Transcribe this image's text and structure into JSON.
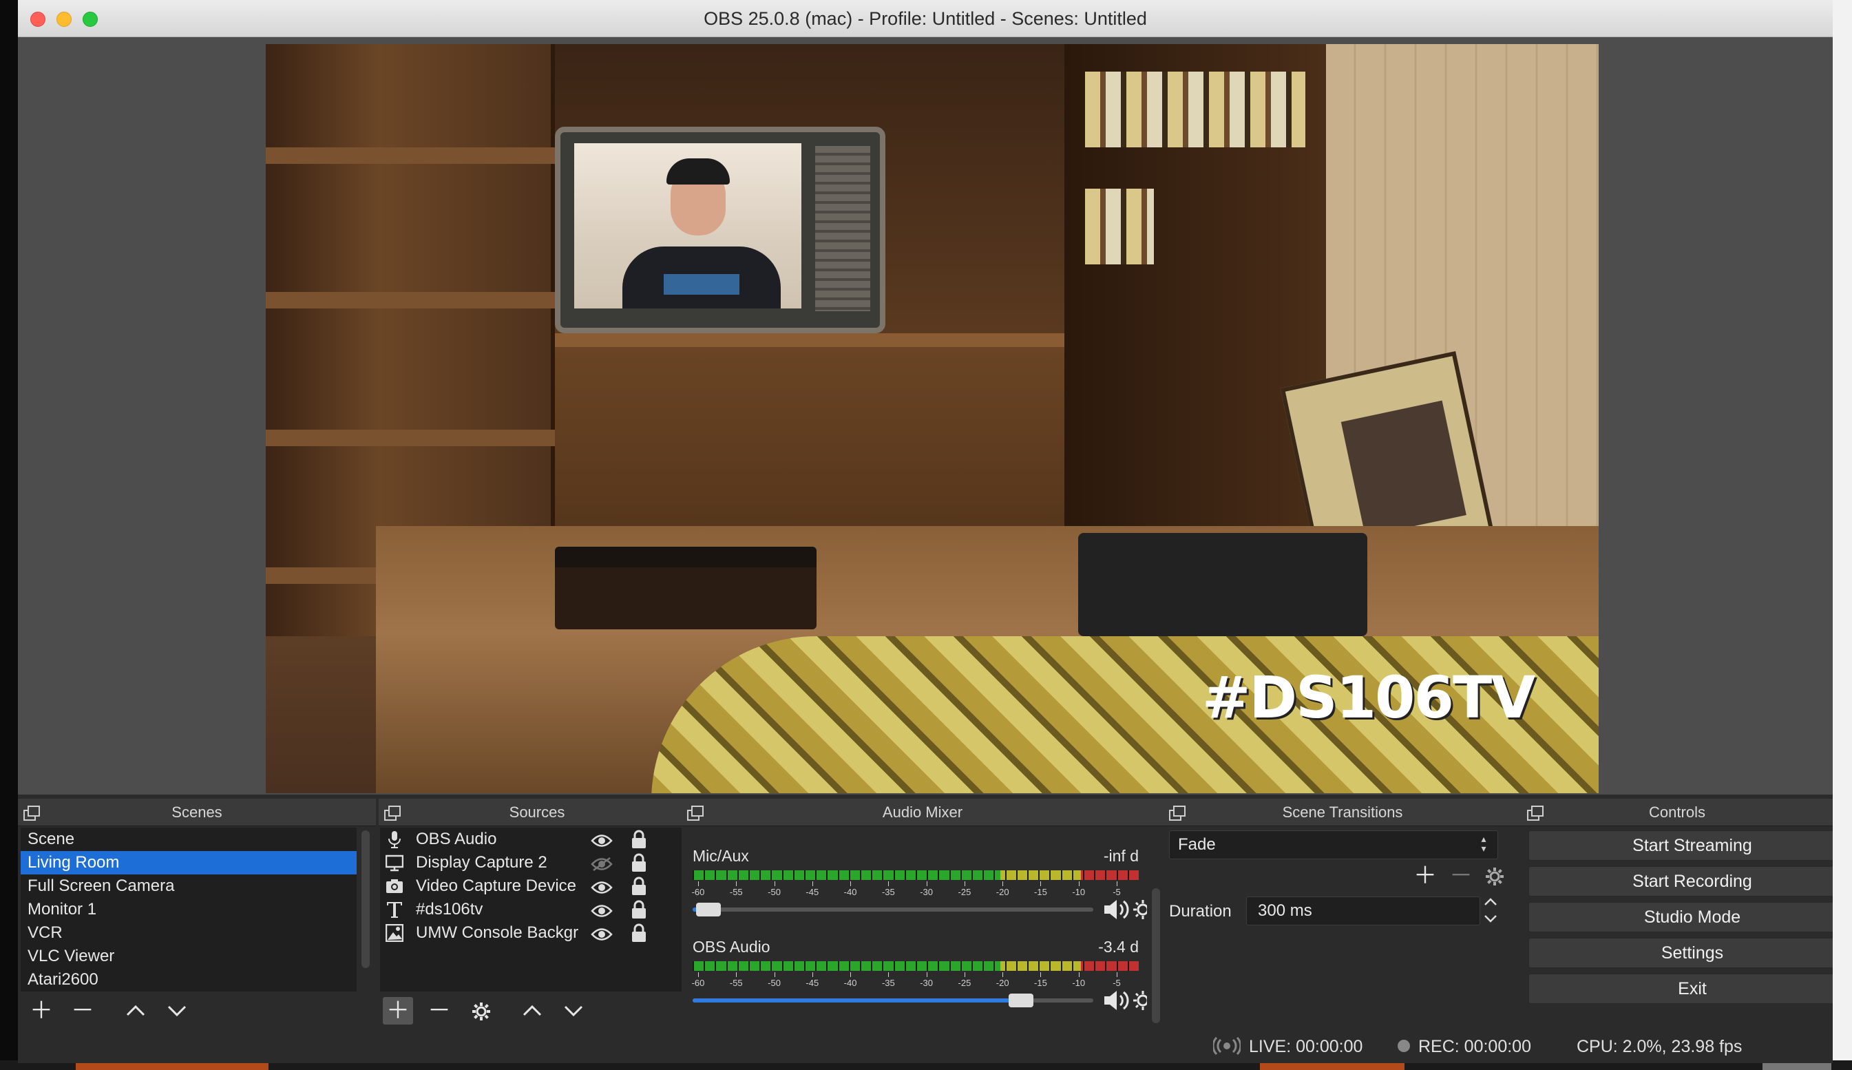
{
  "window": {
    "title": "OBS 25.0.8 (mac) - Profile: Untitled - Scenes: Untitled"
  },
  "preview": {
    "watermark": "#DS106TV"
  },
  "scenes": {
    "title": "Scenes",
    "items": [
      "Scene",
      "Living Room",
      "Full Screen Camera",
      "Monitor 1",
      "VCR",
      "VLC Viewer",
      "Atari2600"
    ],
    "selected_index": 1
  },
  "sources": {
    "title": "Sources",
    "items": [
      {
        "name": "OBS Audio",
        "icon": "microphone-icon",
        "visible": true,
        "locked": true
      },
      {
        "name": "Display Capture 2",
        "icon": "display-icon",
        "visible": false,
        "locked": true
      },
      {
        "name": "Video Capture Device",
        "icon": "camera-icon",
        "visible": true,
        "locked": true
      },
      {
        "name": "#ds106tv",
        "icon": "text-icon",
        "visible": true,
        "locked": true
      },
      {
        "name": "UMW Console Background",
        "icon": "image-icon",
        "visible": true,
        "locked": true
      }
    ]
  },
  "mixer": {
    "title": "Audio Mixer",
    "ticks": [
      "-60",
      "-55",
      "-50",
      "-45",
      "-40",
      "-35",
      "-30",
      "-25",
      "-20",
      "-15",
      "-10",
      "-5"
    ],
    "channels": [
      {
        "name": "Mic/Aux",
        "db": "-inf d",
        "volume": 0.04
      },
      {
        "name": "OBS Audio",
        "db": "-3.4 d",
        "volume": 0.82
      }
    ]
  },
  "transitions": {
    "title": "Scene Transitions",
    "selected": "Fade",
    "duration_label": "Duration",
    "duration_value": "300 ms"
  },
  "controls": {
    "title": "Controls",
    "buttons": [
      "Start Streaming",
      "Start Recording",
      "Studio Mode",
      "Settings",
      "Exit"
    ]
  },
  "status": {
    "live": "LIVE: 00:00:00",
    "rec": "REC: 00:00:00",
    "cpu": "CPU: 2.0%, 23.98 fps"
  },
  "colors": {
    "selection": "#1e6ed8",
    "meter_green": "#2aa62a",
    "meter_yellow": "#b8b82a",
    "meter_red": "#c23030",
    "slider_fill": "#2f7be0"
  }
}
